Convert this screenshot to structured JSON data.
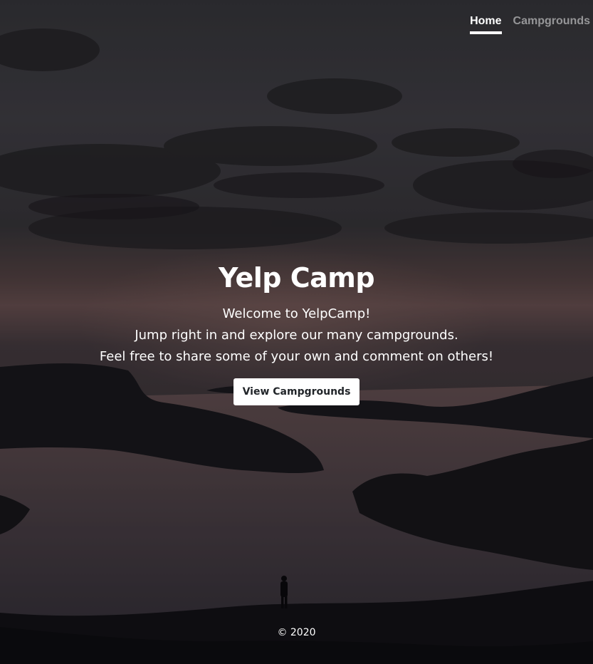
{
  "nav": {
    "items": [
      {
        "label": "Home",
        "active": true
      },
      {
        "label": "Campgrounds",
        "active": false
      }
    ]
  },
  "cover": {
    "title": "Yelp Camp",
    "lines": [
      "Welcome to YelpCamp!",
      "Jump right in and explore our many campgrounds.",
      "Feel free to share some of your own and comment on others!"
    ],
    "button_label": "View Campgrounds"
  },
  "footer": {
    "text": "© 2020"
  },
  "colors": {
    "text": "#ffffff",
    "nav_inactive": "#8a8a8e",
    "button_bg": "#ffffff",
    "button_text": "#212529"
  }
}
